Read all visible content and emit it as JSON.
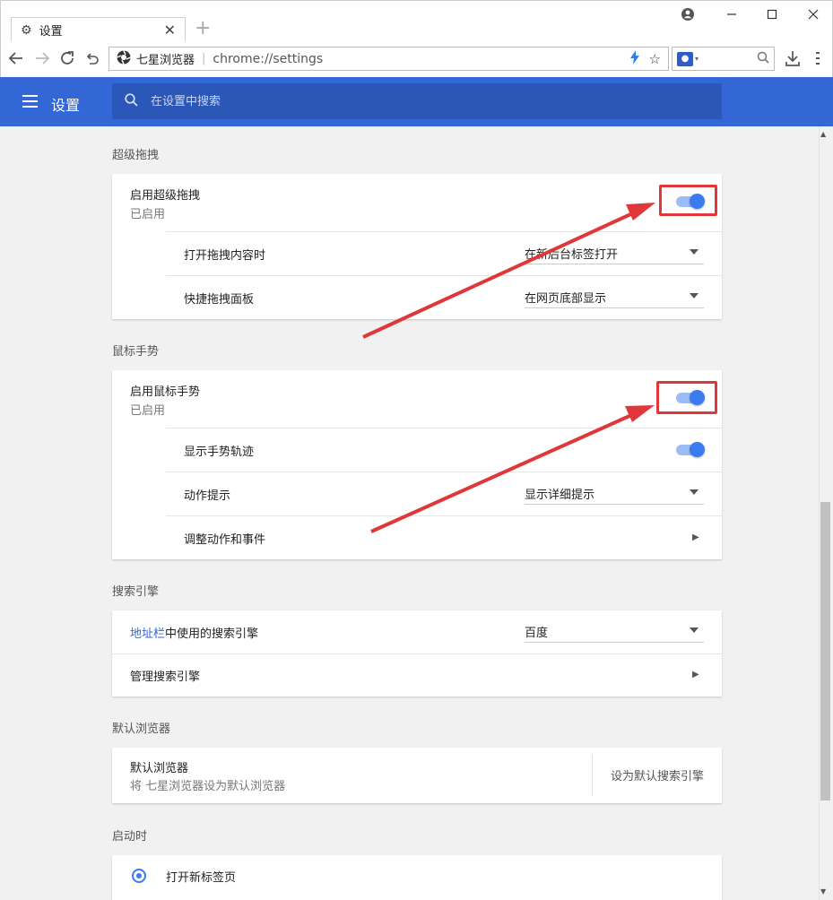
{
  "window": {
    "tab_title": "设置",
    "tab_close": "✕",
    "new_tab": "+"
  },
  "toolbar": {
    "brand": "七星浏览器",
    "url": "chrome://settings"
  },
  "appbar": {
    "title": "设置",
    "search_placeholder": "在设置中搜索"
  },
  "sections": {
    "superdrag": {
      "title": "超级拖拽",
      "enable_label": "启用超级拖拽",
      "enable_status": "已启用",
      "open_drag_label": "打开拖拽内容时",
      "open_drag_value": "在新后台标签打开",
      "quick_panel_label": "快捷拖拽面板",
      "quick_panel_value": "在网页底部显示"
    },
    "gesture": {
      "title": "鼠标手势",
      "enable_label": "启用鼠标手势",
      "enable_status": "已启用",
      "trail_label": "显示手势轨迹",
      "hint_label": "动作提示",
      "hint_value": "显示详细提示",
      "adjust_label": "调整动作和事件"
    },
    "search": {
      "title": "搜索引擎",
      "address_link": "地址栏",
      "address_rest": "中使用的搜索引擎",
      "engine_value": "百度",
      "manage_label": "管理搜索引擎"
    },
    "default_browser": {
      "title": "默认浏览器",
      "label": "默认浏览器",
      "sub": "将 七星浏览器设为默认浏览器",
      "action": "设为默认搜索引擎"
    },
    "startup": {
      "title": "启动时",
      "option": "打开新标签页"
    }
  },
  "colors": {
    "accent": "#3367d6",
    "toggle_on": "#3b7bf1",
    "annotation": "#e0373a"
  }
}
